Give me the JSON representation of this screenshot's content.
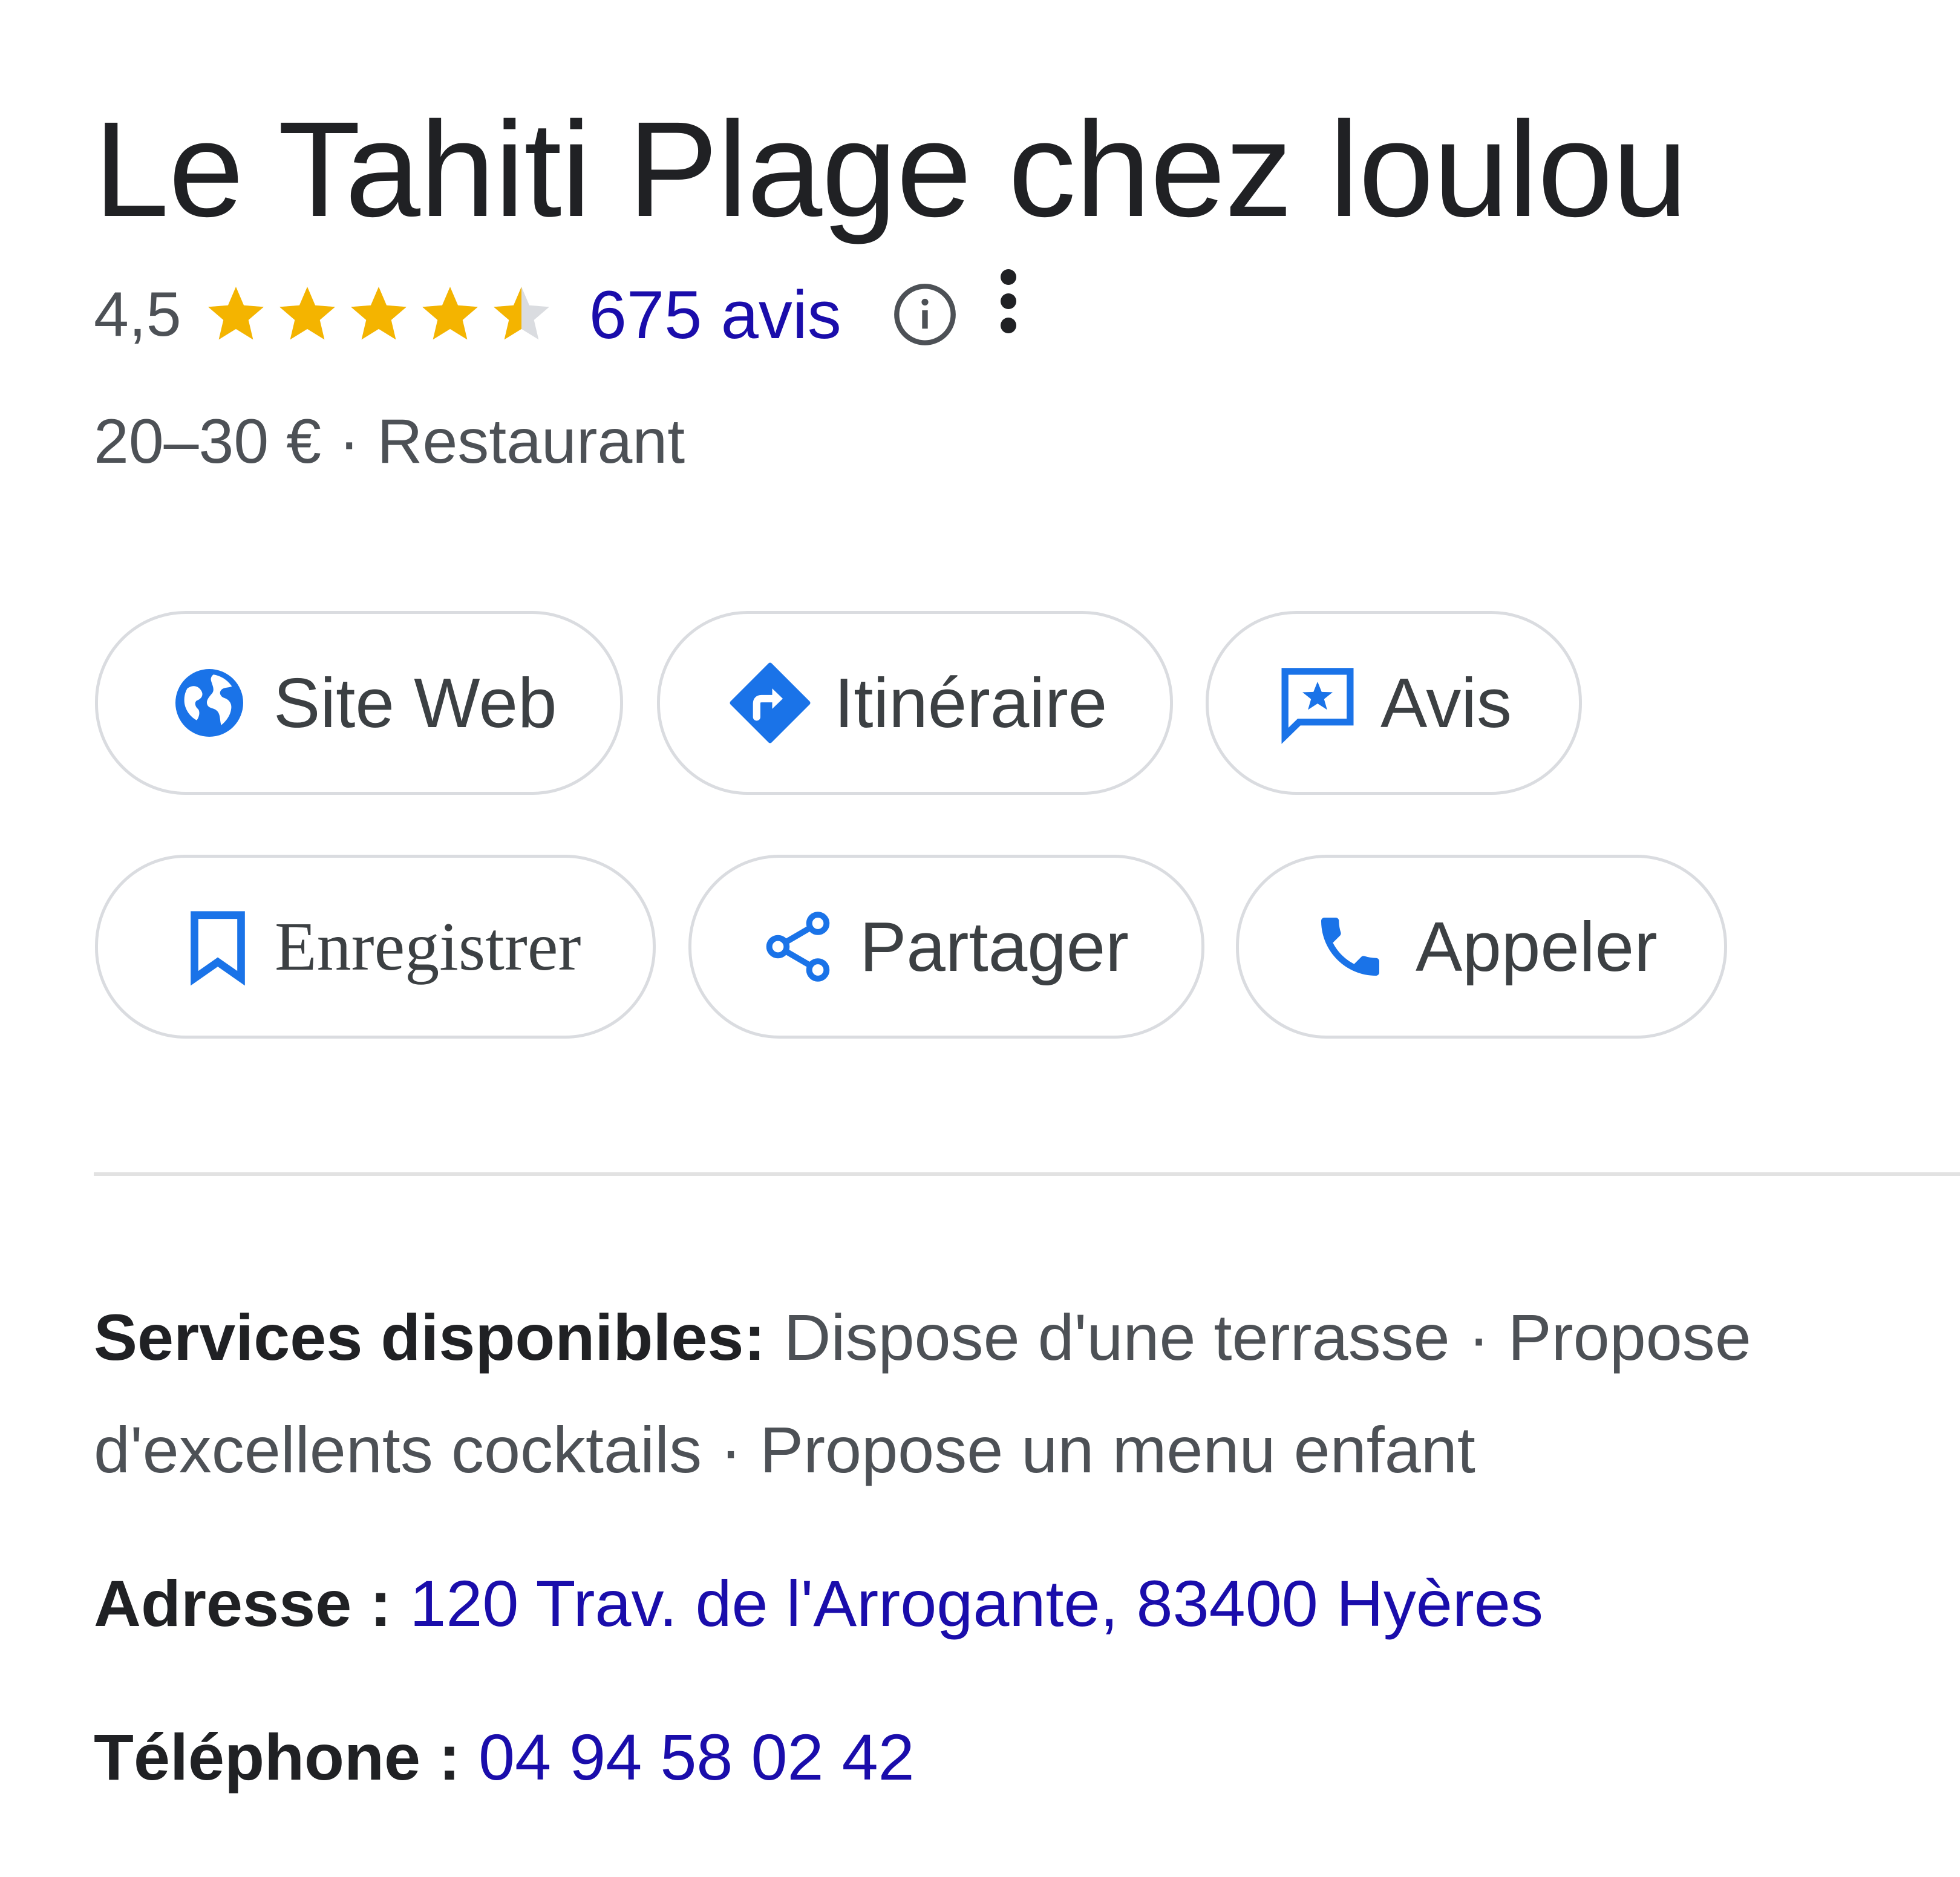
{
  "place": {
    "name": "Le Tahiti Plage chez loulou",
    "rating": "4,5",
    "rating_value": 4.5,
    "rating_max": 5,
    "reviews_link": "675 avis",
    "price_and_category": "20–30 € · Restaurant"
  },
  "actions": {
    "website": "Site Web",
    "directions": "Itinéraire",
    "reviews": "Avis",
    "save": "Enregistrer",
    "share": "Partager",
    "call": "Appeler"
  },
  "details": {
    "services_label": "Services disponibles:",
    "services_value": "Dispose d'une terrasse · Propose d'excellents cocktails · Propose un menu enfant",
    "address_label": "Adresse :",
    "address_value": "120 Trav. de l'Arrogante, 83400 Hyères",
    "phone_label": "Téléphone :",
    "phone_value": "04 94 58 02 42"
  },
  "colors": {
    "star": "#f4b400",
    "star_empty": "#dadce0",
    "link": "#1a0dab",
    "icon_blue": "#1a73e8",
    "chip_border": "#dadce0",
    "text_secondary": "#4d5156"
  },
  "icons": {
    "website": "globe-icon",
    "directions": "directions-diamond-icon",
    "reviews": "review-star-message-icon",
    "save": "bookmark-icon",
    "share": "share-icon",
    "call": "phone-icon",
    "info": "info-icon",
    "more": "more-vert-icon"
  }
}
